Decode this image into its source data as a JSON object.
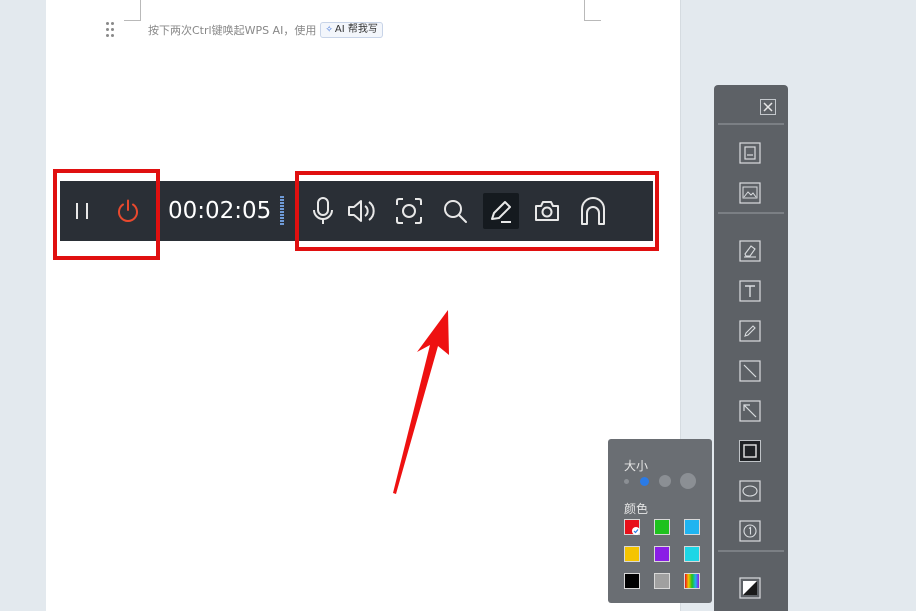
{
  "document": {
    "ai_hint_text": "按下两次Ctrl键唤起WPS AI，使用",
    "ai_badge_label": "AI 帮我写"
  },
  "recorder": {
    "timer": "00:02:05",
    "buttons": [
      {
        "name": "pause",
        "icon": "pause-icon"
      },
      {
        "name": "stop",
        "icon": "power-icon"
      },
      {
        "name": "microphone",
        "icon": "microphone-icon"
      },
      {
        "name": "speaker",
        "icon": "speaker-icon"
      },
      {
        "name": "region-capture",
        "icon": "camera-lens-icon"
      },
      {
        "name": "magnifier",
        "icon": "magnifier-icon"
      },
      {
        "name": "pen",
        "icon": "pen-icon",
        "active": true
      },
      {
        "name": "screenshot",
        "icon": "camera-icon"
      },
      {
        "name": "whiteboard",
        "icon": "arch-icon"
      }
    ],
    "highlight_color": "#e01010",
    "bar_color": "#2a2f36"
  },
  "annotation_toolbar": {
    "tools": [
      "save-icon",
      "image-icon",
      "eraser-icon",
      "text-icon",
      "pencil-icon",
      "line-icon",
      "arrow-icon",
      "rectangle-icon",
      "ellipse-icon",
      "number-marker-icon",
      "fill-toggle-icon"
    ],
    "active_tool": "rectangle-icon"
  },
  "style_popup": {
    "size_label": "大小",
    "color_label": "颜色",
    "selected_size_index": 1,
    "colors": [
      "#e8101a",
      "#1ec21e",
      "#1fb4f0",
      "#f5c400",
      "#8a1ee6",
      "#1ed6e6",
      "#000000",
      "#a0a0a0",
      "gradient"
    ],
    "selected_color": "#e8101a"
  }
}
